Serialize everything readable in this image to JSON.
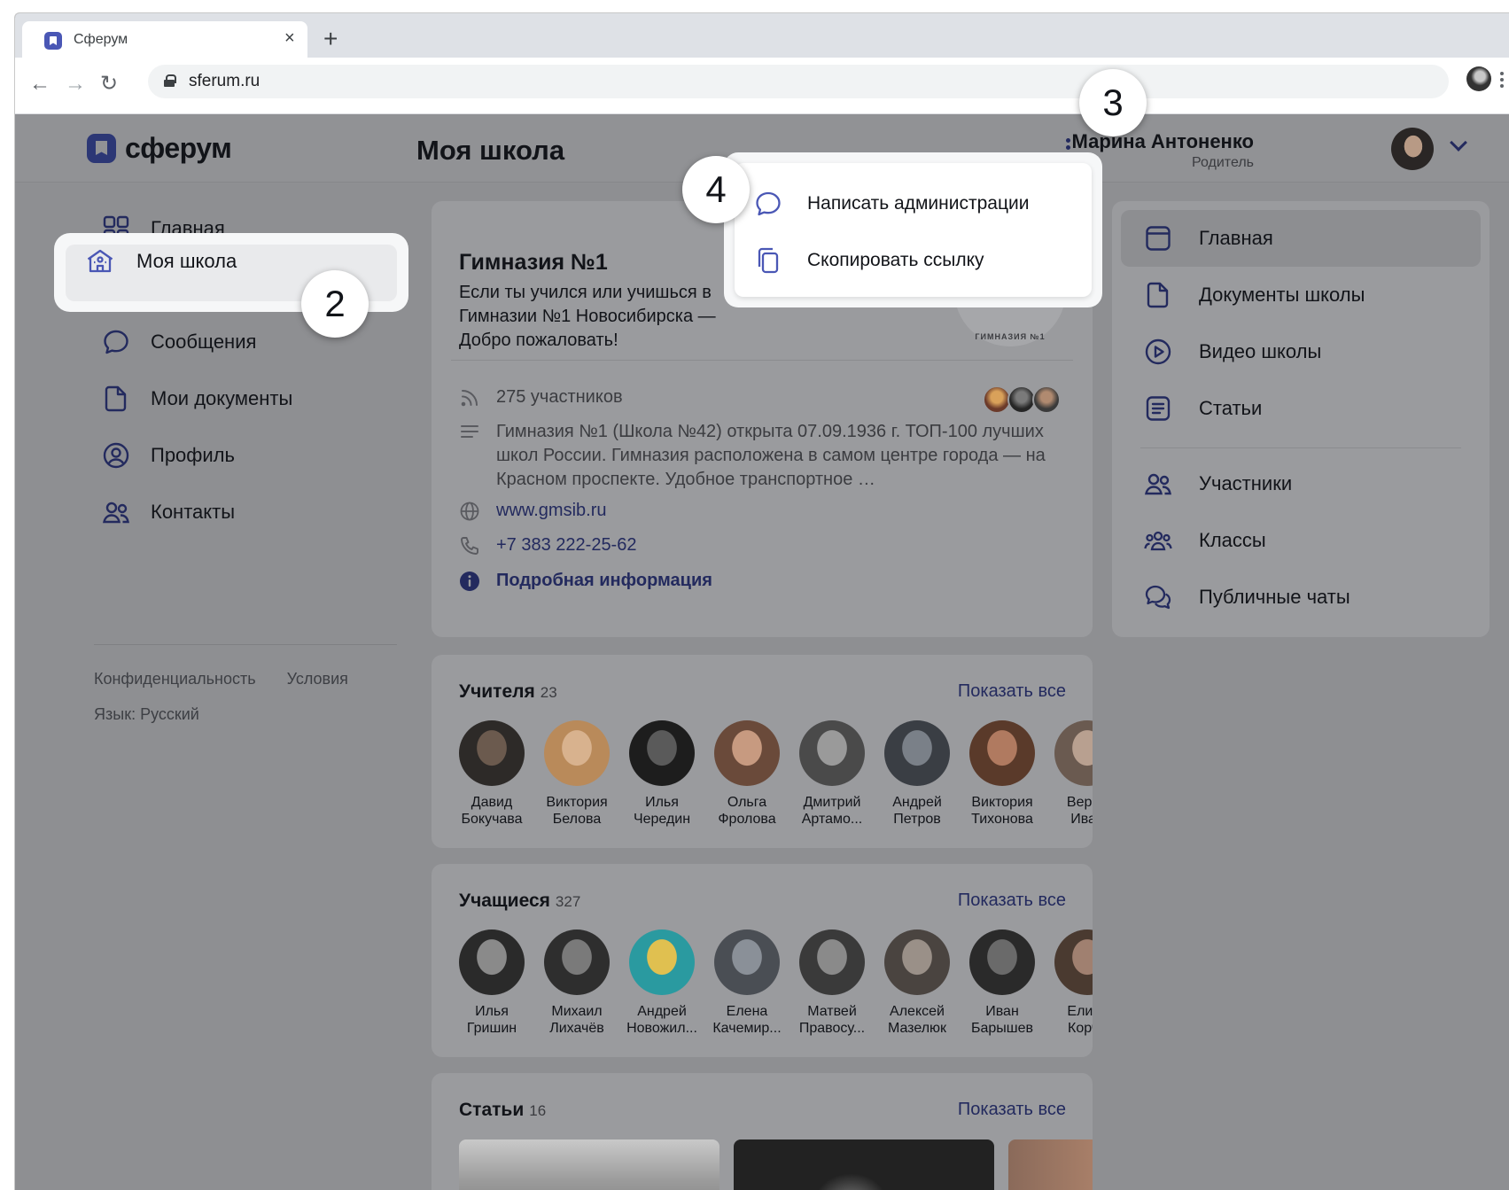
{
  "browser": {
    "tab_title": "Сферум",
    "tab_close": "×",
    "new_tab": "+",
    "url": "sferum.ru",
    "back": "←",
    "forward": "→",
    "reload": "↻"
  },
  "header": {
    "logo_text": "сферум",
    "page_title": "Моя школа",
    "user_name": "Марина Антоненко",
    "user_role": "Родитель"
  },
  "left_nav": {
    "items": [
      {
        "label": "Главная",
        "icon": "grid-icon"
      },
      {
        "label": "Моя школа",
        "icon": "school-icon",
        "active": true
      },
      {
        "label": "Сообщения",
        "icon": "chat-bubble-icon"
      },
      {
        "label": "Мои документы",
        "icon": "document-icon"
      },
      {
        "label": "Профиль",
        "icon": "profile-icon"
      },
      {
        "label": "Контакты",
        "icon": "contacts-icon"
      }
    ],
    "footer": {
      "privacy": "Конфиденциальность",
      "terms": "Условия",
      "language": "Язык: Русский"
    }
  },
  "school": {
    "name": "Гимназия №1",
    "slogan": "Если ты учился или учишься в Гимназии №1 Новосибирска — Добро пожаловать!",
    "logo_text": "ГИМНАЗИЯ №1",
    "members": "275 участников",
    "description": "Гимназия №1 (Школа №42) открыта 07.09.1936 г. ТОП-100 лучших школ России. Гимназия расположена в самом центре города — на Красном проспекте. Удобное транспортное …",
    "website": "www.gmsib.ru",
    "phone": "+7 383 222-25-62",
    "more_info": "Подробная информация"
  },
  "teachers": {
    "title": "Учителя",
    "count": "23",
    "show_all": "Показать все",
    "people": [
      {
        "first": "Давид",
        "last": "Бокучава"
      },
      {
        "first": "Виктория",
        "last": "Белова"
      },
      {
        "first": "Илья",
        "last": "Чередин"
      },
      {
        "first": "Ольга",
        "last": "Фролова"
      },
      {
        "first": "Дмитрий",
        "last": "Артамо..."
      },
      {
        "first": "Андрей",
        "last": "Петров"
      },
      {
        "first": "Виктория",
        "last": "Тихонова"
      },
      {
        "first": "Верон",
        "last": "Иван"
      }
    ]
  },
  "students": {
    "title": "Учащиеся",
    "count": "327",
    "show_all": "Показать все",
    "people": [
      {
        "first": "Илья",
        "last": "Гришин"
      },
      {
        "first": "Михаил",
        "last": "Лихачёв"
      },
      {
        "first": "Андрей",
        "last": "Новожил..."
      },
      {
        "first": "Елена",
        "last": "Качемир..."
      },
      {
        "first": "Матвей",
        "last": "Правосу..."
      },
      {
        "first": "Алексей",
        "last": "Мазелюк"
      },
      {
        "first": "Иван",
        "last": "Барышев"
      },
      {
        "first": "Елиза",
        "last": "Корча"
      }
    ]
  },
  "articles": {
    "title": "Статьи",
    "count": "16",
    "show_all": "Показать все"
  },
  "right_nav": {
    "items": [
      {
        "label": "Главная",
        "icon": "window-icon",
        "active": true
      },
      {
        "label": "Документы школы",
        "icon": "document-icon"
      },
      {
        "label": "Видео школы",
        "icon": "play-icon"
      },
      {
        "label": "Статьи",
        "icon": "article-icon"
      },
      {
        "label": "Участники",
        "icon": "users-icon"
      },
      {
        "label": "Классы",
        "icon": "classes-icon"
      },
      {
        "label": "Публичные чаты",
        "icon": "chats-icon"
      }
    ]
  },
  "dropdown": {
    "write_admin": "Написать администрации",
    "copy_link": "Скопировать ссылку"
  },
  "badges": {
    "step2": "2",
    "step3": "3",
    "step4": "4"
  },
  "colors": {
    "accent": "#4a57b5",
    "dim_overlay": "#8e8f92",
    "link": "#232a5e"
  }
}
